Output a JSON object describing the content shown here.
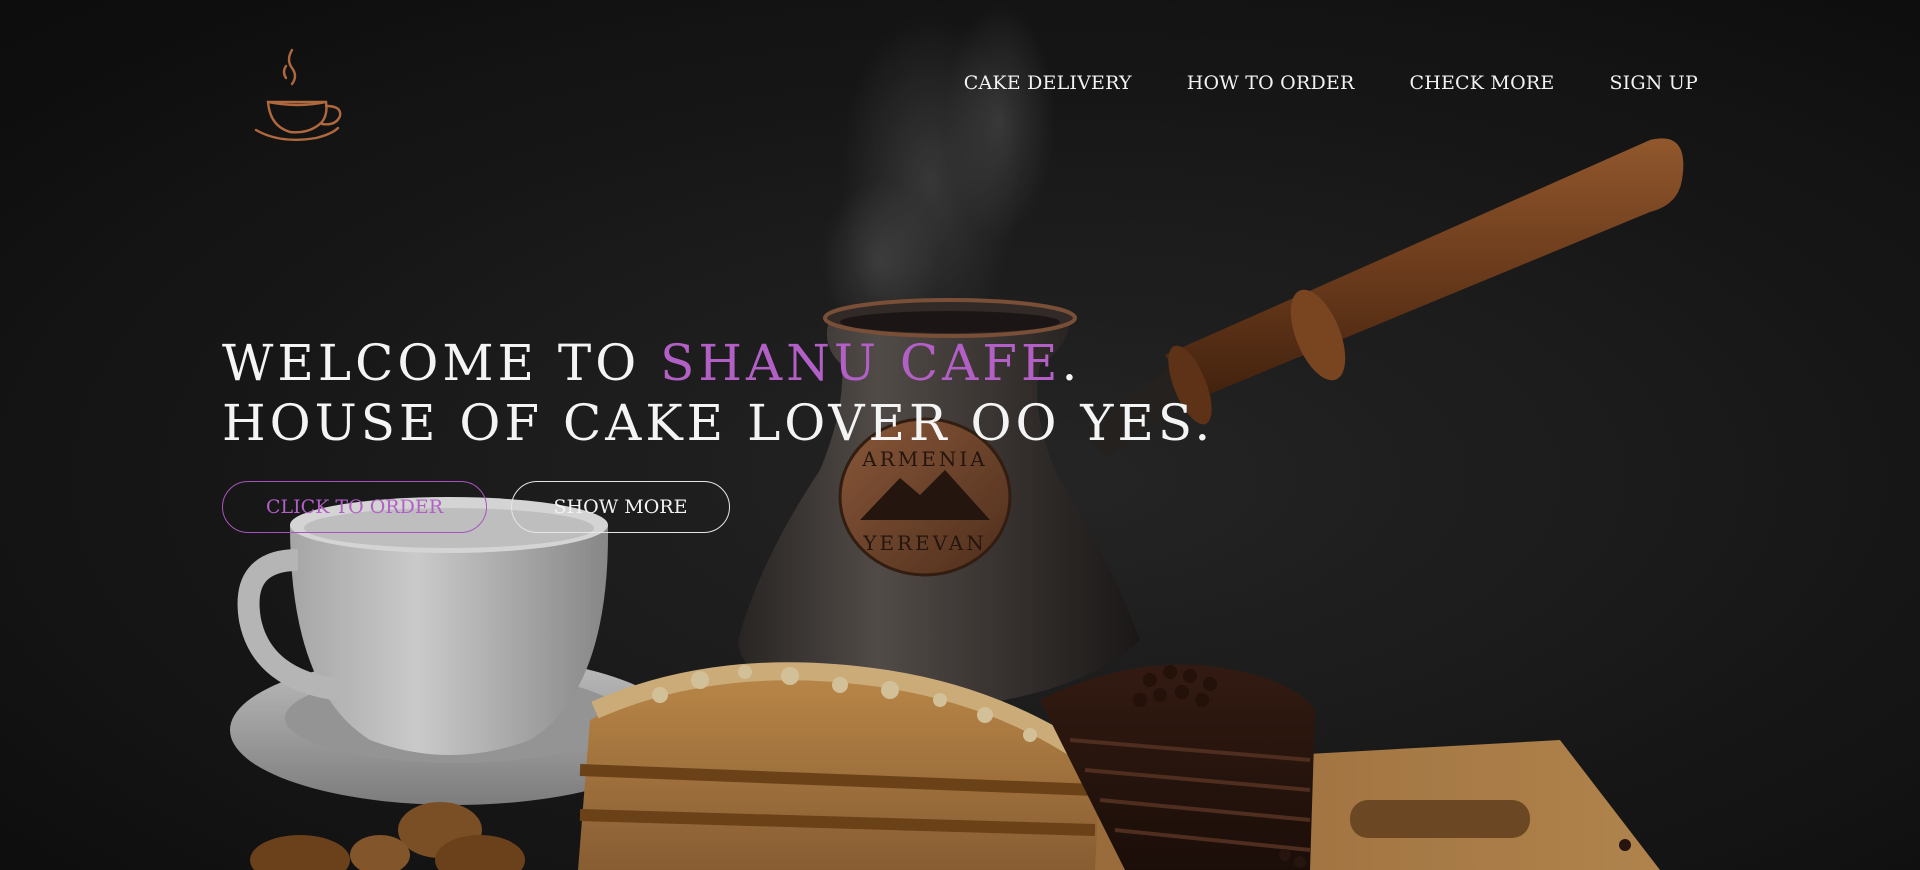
{
  "brand": {
    "logo_icon": "coffee-cup-steam-icon",
    "logo_color": "#b0683f"
  },
  "nav": {
    "items": [
      {
        "label": "CAKE DELIVERY"
      },
      {
        "label": "HOW TO ORDER"
      },
      {
        "label": "CHECK MORE"
      },
      {
        "label": "SIGN UP"
      }
    ]
  },
  "hero": {
    "line1_prefix": "WELCOME TO ",
    "line1_accent": "SHANU CAFE",
    "line1_suffix": ".",
    "line2": "HOUSE OF CAKE LOVER OO YES.",
    "accent_color": "#b25fc6",
    "buttons": {
      "order_label": "CLICK TO ORDER",
      "more_label": "SHOW MORE"
    },
    "pot_stamp": {
      "top_text": "ARMENIA",
      "bottom_text": "YEREVAN"
    }
  }
}
